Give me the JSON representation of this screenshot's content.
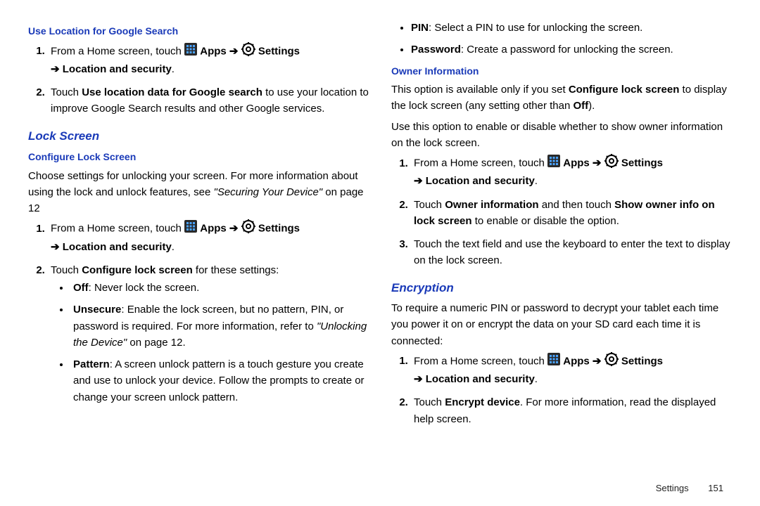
{
  "left": {
    "h_google": "Use Location for Google Search",
    "step_a_prefix": "From a Home screen, touch ",
    "apps_label": "Apps",
    "settings_label": "Settings",
    "loc_sec": "Location and security",
    "step_b": "Touch ",
    "step_b_bold": "Use location data for Google search",
    "step_b_tail": " to use your location to improve Google Search results and other Google services.",
    "h_lock": "Lock Screen",
    "h_conf": "Configure Lock Screen",
    "conf_p1a": "Choose settings for unlocking your screen. For more information about using the lock and unlock features, see ",
    "conf_p1b": "\"Securing Your Device\"",
    "conf_p1c": " on page 12",
    "conf_s2": "Touch ",
    "conf_s2b": "Configure lock screen",
    "conf_s2t": " for these settings:",
    "bl_off_b": "Off",
    "bl_off_t": ": Never lock the screen.",
    "bl_uns_b": "Unsecure",
    "bl_uns_t1": ": Enable the lock screen, but no pattern, PIN, or password is required. For more information, refer to ",
    "bl_uns_t2": "\"Unlocking the Device\"",
    "bl_uns_t3": "  on page 12.",
    "bl_pat_b": "Pattern",
    "bl_pat_t": ": A screen unlock pattern is a touch gesture you create and use to unlock your device. Follow the prompts to create or change your screen unlock pattern."
  },
  "right": {
    "bl_pin_b": "PIN",
    "bl_pin_t": ": Select a PIN to use for unlocking the screen.",
    "bl_pwd_b": "Password",
    "bl_pwd_t": ": Create a password for unlocking the screen.",
    "h_owner": "Owner Information",
    "own_p1a": "This option is available only if you set ",
    "own_p1b": "Configure lock screen",
    "own_p1c": " to display the lock screen (any setting other than ",
    "own_p1d": "Off",
    "own_p1e": ").",
    "own_p2": "Use this option to enable or disable whether to show owner information on the lock screen.",
    "own_s2a": "Touch ",
    "own_s2b": "Owner information",
    "own_s2c": " and then touch ",
    "own_s2d": "Show owner info on lock screen",
    "own_s2e": " to enable or disable the option.",
    "own_s3": "Touch the text field and use the keyboard to enter the text to display on the lock screen.",
    "h_enc": "Encryption",
    "enc_p": "To require a numeric PIN or password to decrypt your tablet each time you power it on or encrypt the data on your SD card each time it is connected:",
    "enc_s2a": "Touch ",
    "enc_s2b": "Encrypt device",
    "enc_s2c": ". For more information, read the displayed help screen."
  },
  "footer": {
    "section": "Settings",
    "page": "151"
  },
  "arrow": "➔"
}
